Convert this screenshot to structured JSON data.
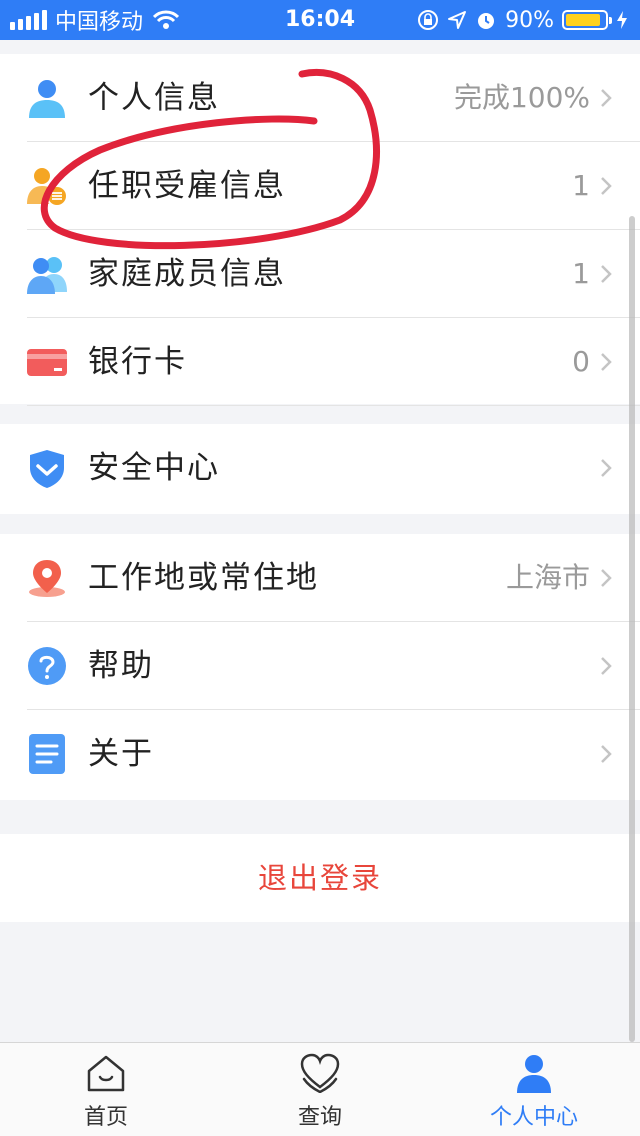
{
  "status_bar": {
    "carrier": "中国移动",
    "time": "16:04",
    "battery": "90%",
    "battery_level": 0.9
  },
  "groups": [
    {
      "rows": [
        {
          "name": "personal-info",
          "label": "个人信息",
          "value": "完成100%",
          "icon": "person-icon"
        },
        {
          "name": "employment-info",
          "label": "任职受雇信息",
          "value": "1",
          "icon": "employment-icon"
        },
        {
          "name": "family-info",
          "label": "家庭成员信息",
          "value": "1",
          "icon": "family-icon"
        },
        {
          "name": "bank-card",
          "label": "银行卡",
          "value": "0",
          "icon": "bank-card-icon"
        }
      ]
    },
    {
      "rows": [
        {
          "name": "security-center",
          "label": "安全中心",
          "value": "",
          "icon": "shield-icon"
        }
      ]
    },
    {
      "rows": [
        {
          "name": "work-location",
          "label": "工作地或常住地",
          "value": "上海市",
          "icon": "location-pin-icon"
        },
        {
          "name": "help",
          "label": "帮助",
          "value": "",
          "icon": "help-icon"
        },
        {
          "name": "about",
          "label": "关于",
          "value": "",
          "icon": "document-icon"
        }
      ]
    }
  ],
  "logout_label": "退出登录",
  "tabs": [
    {
      "label": "首页",
      "icon": "home-icon",
      "active": false
    },
    {
      "label": "查询",
      "icon": "heart-icon",
      "active": false
    },
    {
      "label": "个人中心",
      "icon": "profile-icon",
      "active": true
    }
  ],
  "colors": {
    "accent": "#2f7df6",
    "logout": "#e8463b",
    "annotation": "#e0233a"
  }
}
